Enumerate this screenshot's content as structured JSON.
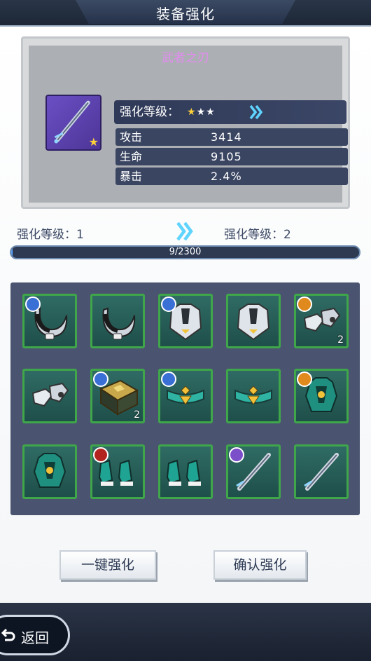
{
  "header": {
    "title": "装备强化"
  },
  "item": {
    "name": "武者之刃",
    "level_label": "强化等级：",
    "stars_filled": "★",
    "stars_empty": "★★",
    "stats": [
      {
        "label": "攻击",
        "value": "3414"
      },
      {
        "label": "生命",
        "value": "9105"
      },
      {
        "label": "暴击",
        "value": "2.4%"
      }
    ]
  },
  "progress": {
    "current_label": "强化等级：1",
    "next_label": "强化等级：2",
    "text": "9/2300",
    "fraction": 0.0039
  },
  "materials": [
    {
      "icon": "crescent-necklace-icon",
      "badge": "blue",
      "count": ""
    },
    {
      "icon": "crescent-necklace-icon",
      "badge": "",
      "count": ""
    },
    {
      "icon": "white-armor-icon",
      "badge": "blue",
      "count": ""
    },
    {
      "icon": "white-armor-icon",
      "badge": "",
      "count": ""
    },
    {
      "icon": "white-boots-icon",
      "badge": "orange",
      "count": "2"
    },
    {
      "icon": "white-boots-icon",
      "badge": "",
      "count": ""
    },
    {
      "icon": "golden-book-icon",
      "badge": "blue",
      "count": "2"
    },
    {
      "icon": "jade-belt-icon",
      "badge": "blue",
      "count": ""
    },
    {
      "icon": "jade-belt-icon",
      "badge": "",
      "count": ""
    },
    {
      "icon": "jade-armor-icon",
      "badge": "orange",
      "count": ""
    },
    {
      "icon": "jade-armor-icon",
      "badge": "",
      "count": ""
    },
    {
      "icon": "jade-boots-icon",
      "badge": "red",
      "count": ""
    },
    {
      "icon": "jade-boots-icon",
      "badge": "",
      "count": ""
    },
    {
      "icon": "sword-icon",
      "badge": "purple",
      "count": ""
    },
    {
      "icon": "sword-icon",
      "badge": "",
      "count": ""
    }
  ],
  "buttons": {
    "one_click": "一键强化",
    "confirm": "确认强化",
    "back": "返回"
  },
  "colors": {
    "badge_blue": "#3a6fd6",
    "badge_orange": "#e08a1e",
    "badge_red": "#b3241f",
    "badge_purple": "#7a4fc9",
    "accent_cyan": "#5fd4ff"
  }
}
